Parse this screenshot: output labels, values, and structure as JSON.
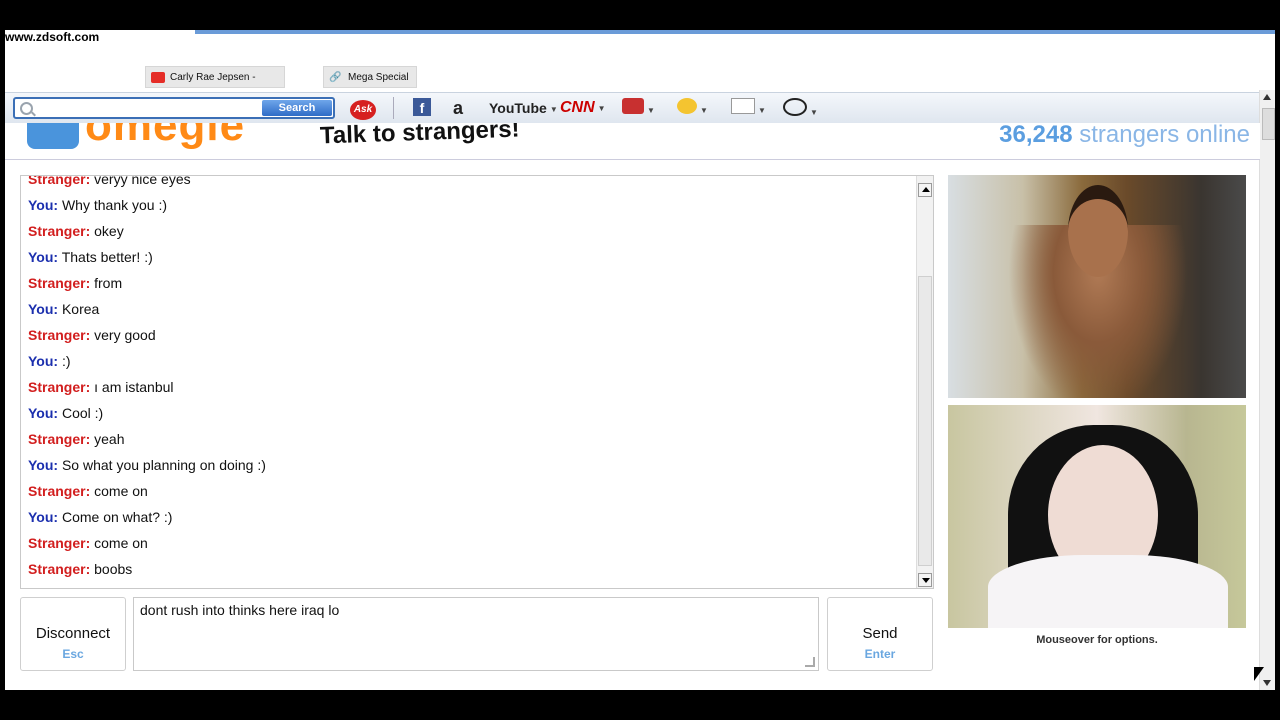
{
  "watermark": "www.zdsoft.com",
  "tabs": [
    {
      "label": "Carly Rae Jepsen - Ca..."
    },
    {
      "label": "Mega Special I"
    }
  ],
  "toolbar": {
    "search_button": "Search",
    "search_placeholder": "",
    "items": [
      "Ask",
      "f",
      "a",
      "YouTube",
      "CNN"
    ]
  },
  "header": {
    "logo": "omegle",
    "tagline": "Talk to strangers!",
    "online_count": "36,248",
    "online_label": "strangers online"
  },
  "chat": {
    "messages": [
      {
        "who": "Stranger:",
        "text": "veryy nice eyes",
        "role": "stranger"
      },
      {
        "who": "You:",
        "text": "Why thank you :)",
        "role": "you"
      },
      {
        "who": "Stranger:",
        "text": "okey",
        "role": "stranger"
      },
      {
        "who": "You:",
        "text": "Thats better! :)",
        "role": "you"
      },
      {
        "who": "Stranger:",
        "text": "from",
        "role": "stranger"
      },
      {
        "who": "You:",
        "text": "Korea",
        "role": "you"
      },
      {
        "who": "Stranger:",
        "text": "very good",
        "role": "stranger"
      },
      {
        "who": "You:",
        "text": ":)",
        "role": "you"
      },
      {
        "who": "Stranger:",
        "text": "ı am istanbul",
        "role": "stranger"
      },
      {
        "who": "You:",
        "text": "Cool :)",
        "role": "you"
      },
      {
        "who": "Stranger:",
        "text": "yeah",
        "role": "stranger"
      },
      {
        "who": "You:",
        "text": "So what you planning on doing :)",
        "role": "you"
      },
      {
        "who": "Stranger:",
        "text": "come on",
        "role": "stranger"
      },
      {
        "who": "You:",
        "text": "Come on what? :)",
        "role": "you"
      },
      {
        "who": "Stranger:",
        "text": "come on",
        "role": "stranger"
      },
      {
        "who": "Stranger:",
        "text": "boobs",
        "role": "stranger"
      }
    ]
  },
  "controls": {
    "disconnect_label": "Disconnect",
    "disconnect_hint": "Esc",
    "message_value": "dont rush into thinks here iraq lo",
    "send_label": "Send",
    "send_hint": "Enter"
  },
  "video": {
    "options_hint": "Mouseover for options."
  },
  "colors": {
    "you": "#1b2fae",
    "stranger": "#d21e1e",
    "accent": "#5b9ee0",
    "logo_orange": "#ff8a16"
  }
}
